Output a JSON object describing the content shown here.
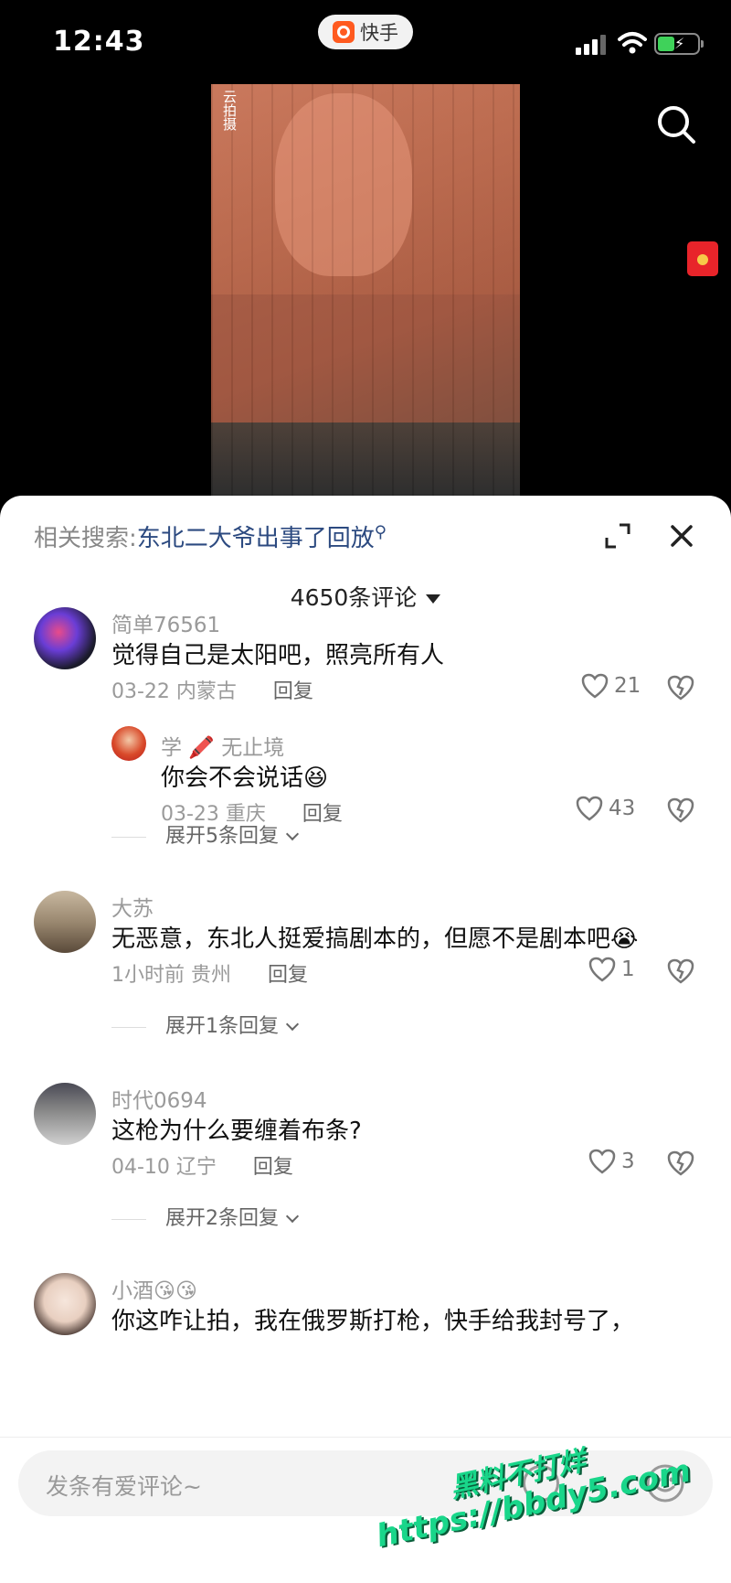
{
  "status": {
    "time": "12:43",
    "app_name": "快手"
  },
  "video": {
    "watermark": "云拍摄"
  },
  "panel": {
    "related_label": "相关搜索:",
    "related_term": "东北二大爷出事了回放",
    "comment_count": "4650条评论"
  },
  "comments": [
    {
      "username": "简单76561",
      "text": "觉得自己是太阳吧，照亮所有人",
      "date": "03-22 内蒙古",
      "reply": "回复",
      "likes": "21"
    },
    {
      "username": "学 🖍️ 无止境",
      "text": "你会不会说话😆",
      "date": "03-23 重庆",
      "reply": "回复",
      "likes": "43"
    },
    {
      "username": "大苏",
      "text": "无恶意，东北人挺爱搞剧本的，但愿不是剧本吧😭",
      "date": "1小时前 贵州",
      "reply": "回复",
      "likes": "1"
    },
    {
      "username": "时代0694",
      "text": "这枪为什么要缠着布条?",
      "date": "04-10 辽宁",
      "reply": "回复",
      "likes": "3"
    },
    {
      "username": "小酒😘😘",
      "text": "你这咋让拍，我在俄罗斯打枪，快手给我封号了，"
    }
  ],
  "expand": [
    "展开5条回复",
    "展开1条回复",
    "展开2条回复"
  ],
  "input": {
    "placeholder": "发条有爱评论~"
  },
  "watermark_site": {
    "line1": "黑料不打烊",
    "line2": "https://bbdy5.com"
  },
  "colors": {
    "accent_link": "#2c4a80",
    "brand": "#ff5a1f",
    "watermark": "#19d68a"
  }
}
